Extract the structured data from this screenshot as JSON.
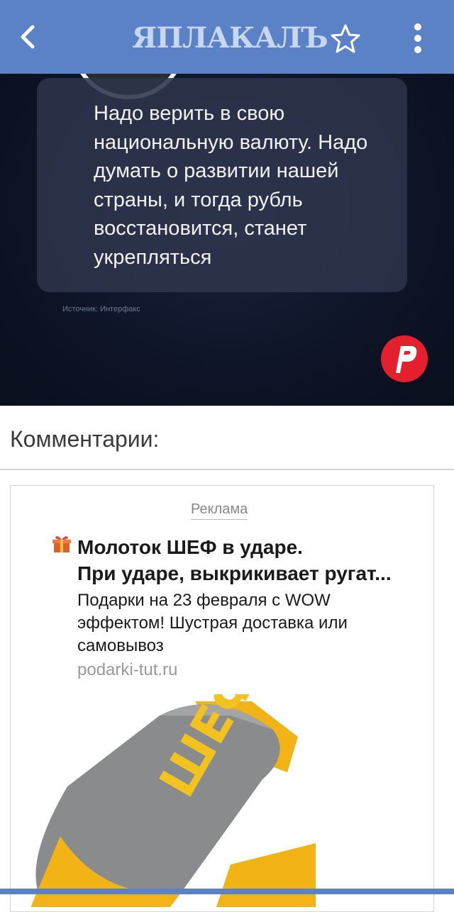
{
  "header": {
    "logo": "ЯПЛАКАЛЪ",
    "back_icon": "chevron-left-icon",
    "favorite_icon": "star-outline-icon",
    "menu_icon": "kebab-menu-icon",
    "colors": {
      "bar": "#5b82c6",
      "logo": "#c8d7f0"
    }
  },
  "post_image": {
    "quote": "Надо верить в свою национальную валюту. Надо думать о развитии нашей страны, и тогда рубль восстановится, станет укрепляться",
    "source": "Источник: Интерфакс",
    "badge_icon": "red-p-logo-icon",
    "colors": {
      "background": "#0e1426",
      "badge": "#e5202e"
    }
  },
  "comments": {
    "title": "Комментарии:"
  },
  "ad": {
    "label": "Реклама",
    "icon": "gift-box-icon",
    "headline_line1": "Молоток ШЕФ в ударе.",
    "headline_line2": "При ударе, выкрикивает ругат...",
    "description": "Подарки на 23 февраля с WOW эффектом! Шустрая доставка или самовывоз",
    "domain": "podarki-tut.ru",
    "product_text": "ШЕФ",
    "colors": {
      "product_gray": "#8a8b8c",
      "product_yellow": "#f2b316"
    }
  }
}
